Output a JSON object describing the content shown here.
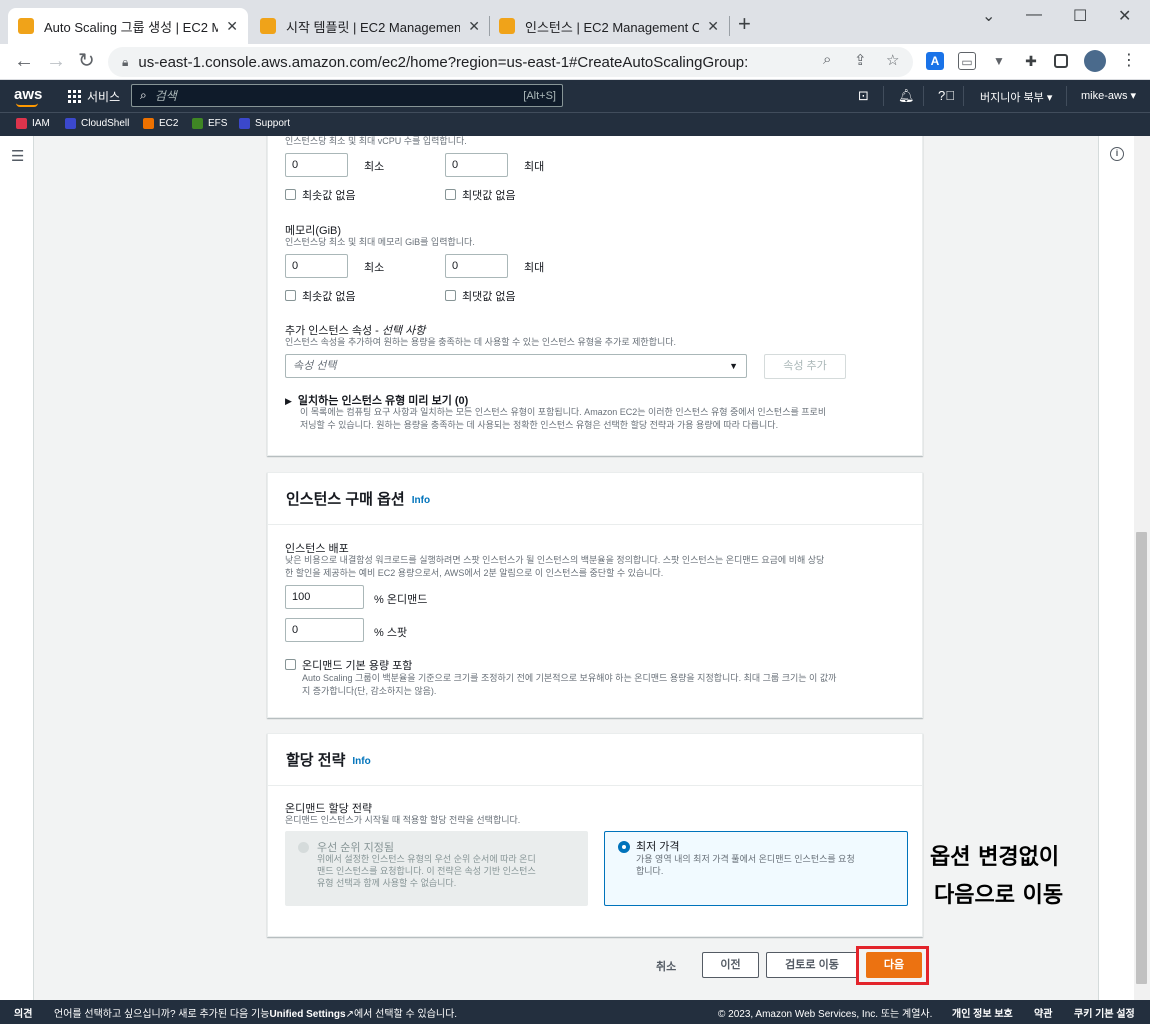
{
  "browser": {
    "tabs": [
      {
        "title": "Auto Scaling 그룹 생성 | EC2 Ma",
        "active": true
      },
      {
        "title": "시작 템플릿 | EC2 Management",
        "active": false
      },
      {
        "title": "인스턴스 | EC2 Management Co",
        "active": false
      }
    ],
    "url": "us-east-1.console.aws.amazon.com/ec2/home?region=us-east-1#CreateAutoScalingGroup:"
  },
  "aws_nav": {
    "logo": "aws",
    "services": "서비스",
    "search_placeholder": "검색",
    "search_shortcut": "[Alt+S]",
    "region": "버지니아 북부 ▾",
    "user": "mike-aws ▾"
  },
  "favorites": [
    "IAM",
    "CloudShell",
    "EC2",
    "EFS",
    "Support"
  ],
  "vcpu_section": {
    "cut_desc": "인스턴스당 최소 및 최대 vCPU 수를 입력합니다.",
    "min_value": "0",
    "min_label": "최소",
    "max_value": "0",
    "max_label": "최대",
    "no_min": "최솟값 없음",
    "no_max": "최댓값 없음"
  },
  "memory_section": {
    "title": "메모리(GiB)",
    "desc": "인스턴스당 최소 및 최대 메모리 GiB를 입력합니다.",
    "min_value": "0",
    "min_label": "최소",
    "max_value": "0",
    "max_label": "최대",
    "no_min": "최솟값 없음",
    "no_max": "최댓값 없음"
  },
  "additional_attrs": {
    "title": "추가 인스턴스 속성 - ",
    "title_optional": "선택 사항",
    "desc": "인스턴스 속성을 추가하여 원하는 용량을 충족하는 데 사용할 수 있는 인스턴스 유형을 추가로 제한합니다.",
    "select_placeholder": "속성 선택",
    "add_button": "속성 추가"
  },
  "preview": {
    "title": "일치하는 인스턴스 유형 미리 보기 (0)",
    "desc_line1": "이 목록에는 컴퓨팅 요구 사항과 일치하는 모든 인스턴스 유형이 포함됩니다. Amazon EC2는 이러한 인스턴스 유형 중에서 인스턴스를 프로비",
    "desc_line2": "저닝할 수 있습니다. 원하는 용량을 충족하는 데 사용되는 정확한 인스턴스 유형은 선택한 할당 전략과 가용 용량에 따라 다릅니다."
  },
  "purchase_options": {
    "title": "인스턴스 구매 옵션",
    "info": "Info",
    "dist_title": "인스턴스 배포",
    "dist_desc1": "낮은 비용으로 내결함성 워크로드를 실행하려면 스팟 인스턴스가 될 인스턴스의 백분율을 정의합니다. 스팟 인스턴스는 온디맨드 요금에 비해 상당",
    "dist_desc2": "한 할인을 제공하는 예비 EC2 용량으로서, AWS에서 2분 알림으로 이 인스턴스를 중단할 수 있습니다.",
    "ondemand_value": "100",
    "ondemand_label": "% 온디맨드",
    "spot_value": "0",
    "spot_label": "% 스팟",
    "base_label": "온디맨드 기본 용량 포함",
    "base_desc1": "Auto Scaling 그룹이 백분율을 기준으로 크기를 조정하기 전에 기본적으로 보유해야 하는 온디맨드 용량을 지정합니다. 최대 그룹 크기는 이 값까",
    "base_desc2": "지 증가합니다(단, 감소하지는 않음)."
  },
  "allocation": {
    "title": "할당 전략",
    "info": "Info",
    "od_title": "온디맨드 할당 전략",
    "od_desc": "온디맨드 인스턴스가 시작될 때 적용할 할당 전략을 선택합니다.",
    "opt1_title": "우선 순위 지정됨",
    "opt1_desc1": "위에서 설정한 인스턴스 유형의 우선 순위 순서에 따라 온디",
    "opt1_desc2": "맨드 인스턴스를 요청합니다. 이 전략은 속성 기반 인스턴스",
    "opt1_desc3": "유형 선택과 함께 사용할 수 없습니다.",
    "opt2_title": "최저 가격",
    "opt2_desc1": "가용 영역 내의 최저 가격 풀에서 온디맨드 인스턴스를 요청",
    "opt2_desc2": "합니다."
  },
  "footer_actions": {
    "cancel": "취소",
    "prev": "이전",
    "review": "검토로 이동",
    "next": "다음"
  },
  "annotation": {
    "line1": "옵션 변경없이",
    "line2": "다음으로 이동"
  },
  "bottom_bar": {
    "feedback": "의견",
    "lang_msg": "언어를 선택하고 싶으십니까? 새로 추가된 다음 기능",
    "unified": "Unified Settings",
    "lang_msg2": "에서 선택할 수 있습니다.",
    "copyright": "© 2023, Amazon Web Services, Inc. 또는 계열사.",
    "privacy": "개인 정보 보호",
    "terms": "약관",
    "cookies": "쿠키 기본 설정"
  },
  "colors": {
    "aws_dark": "#232f3e",
    "aws_orange": "#ec7211",
    "link_blue": "#0073bb",
    "highlight_red": "#e3242b"
  }
}
